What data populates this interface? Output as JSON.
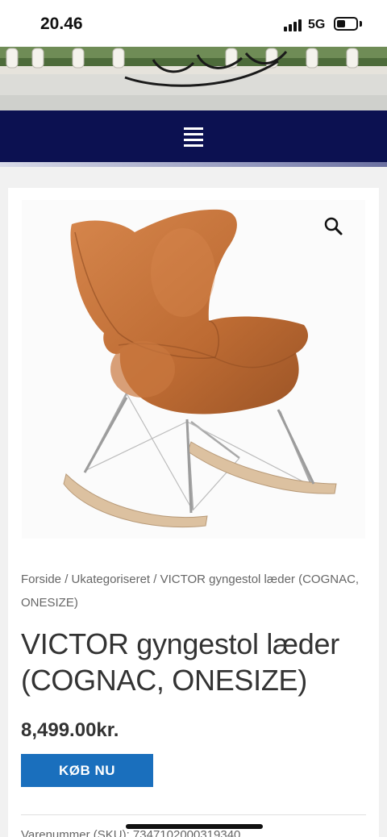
{
  "status_bar": {
    "time": "20.46",
    "network": "5G"
  },
  "product": {
    "image_alt": "VICTOR gyngestol læder",
    "breadcrumb": {
      "home": "Forside",
      "category": "Ukategoriseret",
      "current": "VICTOR gyngestol læder (COGNAC, ONESIZE)",
      "separator": " / "
    },
    "title": "VICTOR gyngestol læder (COGNAC, ONESIZE)",
    "price": "8,499.00kr.",
    "buy_label": "KØB NU",
    "sku_line": "Varenummer (SKU): 7347102000319340"
  },
  "icons": {
    "menu": "hamburger-icon",
    "zoom": "search-icon"
  },
  "colors": {
    "nav_background": "#0c1151",
    "buy_button": "#1a6fbd",
    "leather": "#c0713a"
  }
}
